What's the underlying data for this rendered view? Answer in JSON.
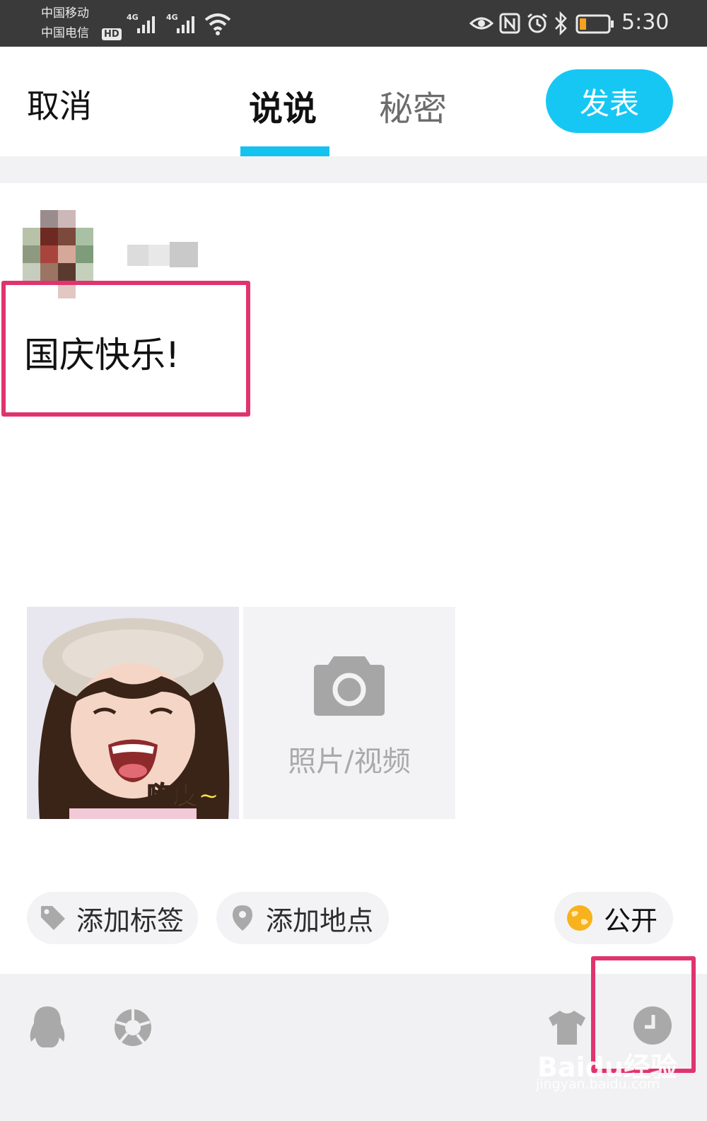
{
  "status_bar": {
    "carrier1": "中国移动",
    "carrier2": "中国电信",
    "hd_badge": "HD",
    "network1": "4G",
    "network2": "4G",
    "time": "5:30",
    "icons": [
      "signal-icon",
      "wifi-icon",
      "eye-icon",
      "nfc-icon",
      "alarm-icon",
      "bluetooth-icon",
      "battery-icon"
    ]
  },
  "header": {
    "cancel_label": "取消",
    "tabs": [
      {
        "label": "说说",
        "active": true
      },
      {
        "label": "秘密",
        "active": false
      }
    ],
    "publish_label": "发表",
    "accent_color": "#16c7f4"
  },
  "post": {
    "text": "国庆快乐!",
    "images": [
      {
        "caption": "嗨皮~"
      }
    ],
    "add_media_label": "照片/视频"
  },
  "actions": {
    "tag_label": "添加标签",
    "location_label": "添加地点",
    "visibility_label": "公开"
  },
  "toolbar": {
    "icons": [
      "qq-penguin-icon",
      "shutter-icon",
      "tshirt-icon",
      "clock-icon"
    ]
  },
  "watermark": {
    "line1": "Baidu经验",
    "line2": "jingyan.baidu.com"
  },
  "colors": {
    "highlight": "#e0346e",
    "globe": "#f7b21d"
  }
}
